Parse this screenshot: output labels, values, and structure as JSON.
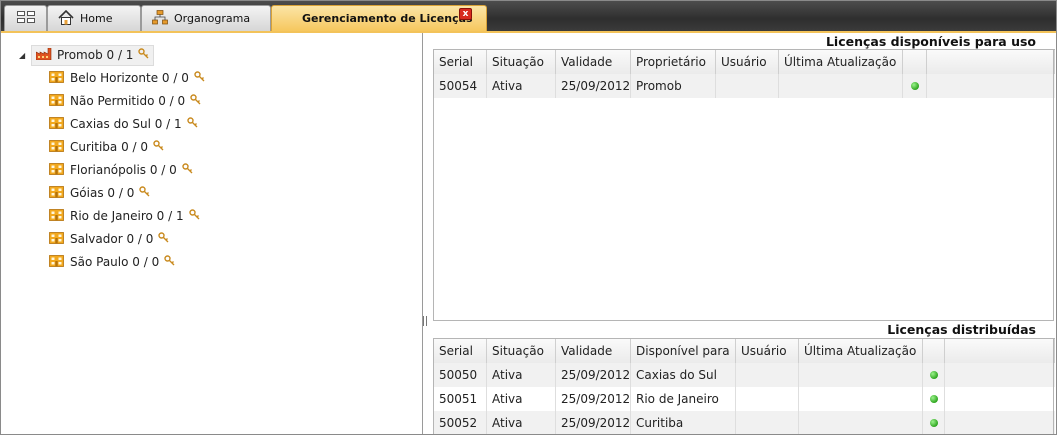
{
  "tabs": {
    "home": "Home",
    "organograma": "Organograma",
    "licencas": "Gerenciamento de Licenças",
    "close": "x"
  },
  "tree": {
    "root": "Promob 0 / 1",
    "nodes": [
      "Belo Horizonte 0 / 0",
      "Não Permitido 0 / 0",
      "Caxias do Sul 0 / 1",
      "Curitiba 0 / 0",
      "Florianópolis 0 / 0",
      "Góias 0 / 0",
      "Rio de Janeiro 0 / 1",
      "Salvador 0 / 0",
      "São Paulo 0 / 0"
    ]
  },
  "available": {
    "title": "Licenças disponíveis para uso",
    "columns": [
      "Serial",
      "Situação",
      "Validade",
      "Proprietário",
      "Usuário",
      "Última Atualização"
    ],
    "rows": [
      {
        "serial": "50054",
        "situacao": "Ativa",
        "validade": "25/09/2012",
        "proprietario": "Promob",
        "usuario": "",
        "atualizacao": "",
        "status": "green"
      }
    ]
  },
  "distributed": {
    "title": "Licenças distribuídas",
    "columns": [
      "Serial",
      "Situação",
      "Validade",
      "Disponível para",
      "Usuário",
      "Última Atualização"
    ],
    "rows": [
      {
        "serial": "50050",
        "situacao": "Ativa",
        "validade": "25/09/2012",
        "disponivel": "Caxias do Sul",
        "usuario": "",
        "atualizacao": "",
        "status": "green"
      },
      {
        "serial": "50051",
        "situacao": "Ativa",
        "validade": "25/09/2012",
        "disponivel": "Rio de Janeiro",
        "usuario": "",
        "atualizacao": "",
        "status": "green"
      },
      {
        "serial": "50052",
        "situacao": "Ativa",
        "validade": "25/09/2012",
        "disponivel": "Curitiba",
        "usuario": "",
        "atualizacao": "",
        "status": "green"
      }
    ]
  },
  "colors": {
    "active_tab": "#f6c75e",
    "status_green": "#2ea51f",
    "building_icon": "#f2a81d"
  }
}
